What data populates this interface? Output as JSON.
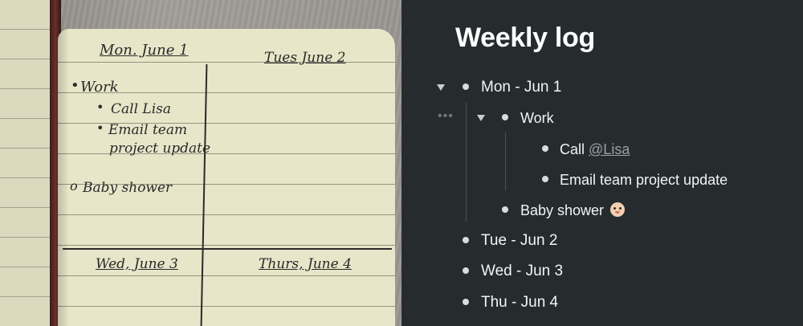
{
  "notebook": {
    "headings": [
      "Mon. June 1",
      "Tues June 2",
      "Wed, June 3",
      "Thurs, June 4"
    ],
    "entries": [
      "Work",
      "Call Lisa",
      "Email team",
      "project update",
      "Baby shower"
    ]
  },
  "log": {
    "title": "Weekly log",
    "days": {
      "mon": "Mon - Jun 1",
      "tue": "Tue - Jun 2",
      "wed": "Wed - Jun 3",
      "thu": "Thu - Jun 4"
    },
    "work": "Work",
    "call": "Call",
    "mention": "@Lisa",
    "email": "Email team project update",
    "baby": "Baby shower",
    "baby_emoji_icon": "baby-face-icon",
    "drag_handle": "•••"
  },
  "colors": {
    "panel_bg": "#262c2e",
    "text": "#f2f4f5",
    "mention": "#9aa0a4",
    "paper": "#e7e6c9"
  }
}
